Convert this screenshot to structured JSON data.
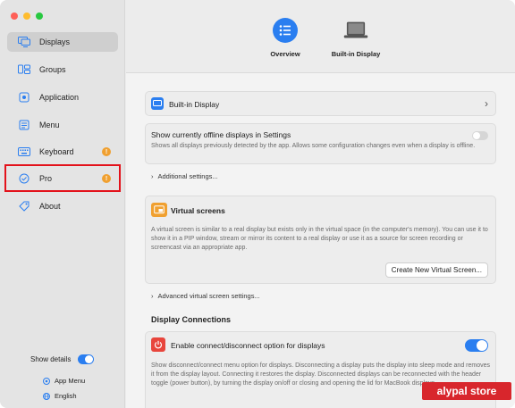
{
  "sidebar": {
    "items": [
      {
        "label": "Displays",
        "icon": "displays-icon"
      },
      {
        "label": "Groups",
        "icon": "groups-icon"
      },
      {
        "label": "Application",
        "icon": "application-icon"
      },
      {
        "label": "Menu",
        "icon": "menu-icon"
      },
      {
        "label": "Keyboard",
        "icon": "keyboard-icon"
      },
      {
        "label": "Pro",
        "icon": "pro-badge-icon"
      },
      {
        "label": "About",
        "icon": "about-tag-icon"
      }
    ],
    "show_details_label": "Show details",
    "app_menu_label": "App Menu",
    "language_label": "English"
  },
  "toolbar": {
    "tabs": [
      {
        "label": "Overview",
        "icon": "list-icon"
      },
      {
        "label": "Built-in Display",
        "icon": "laptop-icon"
      }
    ]
  },
  "builtin_row": {
    "label": "Built-in Display"
  },
  "offline_row": {
    "title": "Show currently offline displays in Settings",
    "description": "Shows all displays previously detected by the app. Allows some configuration changes even when a display is offline."
  },
  "additional_settings": {
    "label": "Additional settings..."
  },
  "virtual_screens": {
    "title": "Virtual screens",
    "description": "A virtual screen is similar to a real display but exists only in the virtual space (in the computer's memory). You can use it to show it in a PIP window, stream or mirror its content to a real display or use it as a source for screen recording or screencast via an appropriate app.",
    "button_label": "Create New Virtual Screen..."
  },
  "advanced_virtual": {
    "label": "Advanced virtual screen settings..."
  },
  "display_connections": {
    "section_title": "Display Connections",
    "enable_title": "Enable connect/disconnect option for displays",
    "description": "Show disconnect/connect menu option for displays. Disconnecting a display puts the display into sleep mode and removes it from the display layout. Connecting it restores the display. Disconnected displays can be reconnected with the header toggle (power button), by turning the display on/off or closing and opening the lid for MacBook displays."
  },
  "watermark": {
    "text": "alypal store"
  },
  "colors": {
    "accent": "#2a7ef0",
    "badge": "#f0a030",
    "highlight": "#e3121b"
  }
}
